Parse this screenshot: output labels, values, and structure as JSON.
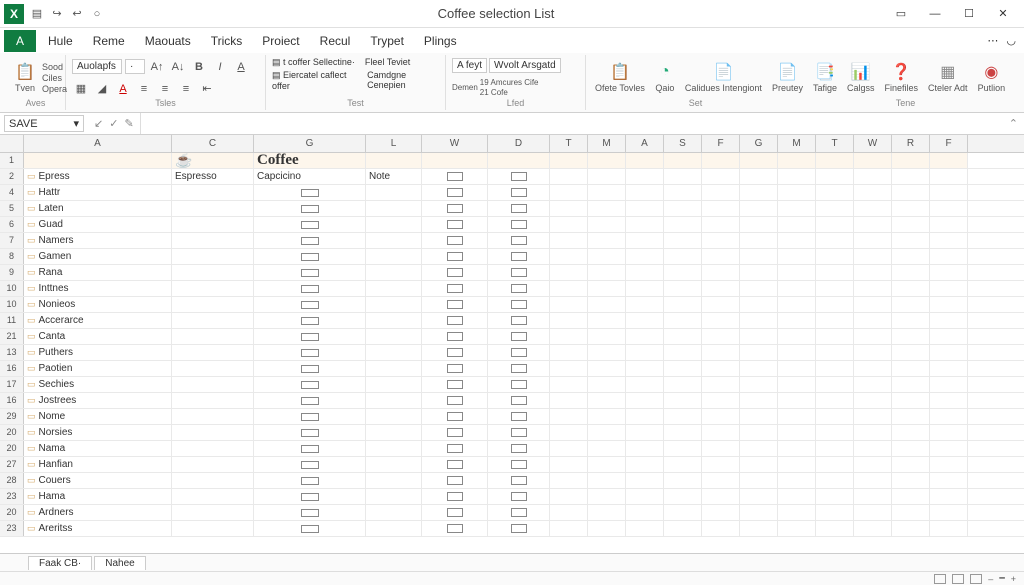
{
  "title": "Coffee selection List",
  "qat": [
    "save-icon",
    "redo-icon",
    "undo-icon",
    "close-icon"
  ],
  "window_buttons": {
    "ribbon_opts": "▭",
    "min": "—",
    "max": "☐",
    "close": "✕"
  },
  "file_tab": "A",
  "tabs": [
    "Hule",
    "Reme",
    "Maouats",
    "Tricks",
    "Proiect",
    "Recul",
    "Trypet",
    "Plings"
  ],
  "ribbon": {
    "paste_group": {
      "paste": "Tven",
      "lines": [
        "Sood",
        "Ciles",
        "Opera"
      ],
      "label": "Aves"
    },
    "font_group": {
      "font": "Auolapfs",
      "size": "·",
      "label": "Tsles"
    },
    "text_group": {
      "line1": "t coffer Sellectine·",
      "line2": "Eiercatel caflect offer",
      "r1": "Fleel Teviet",
      "r2": "Camdgne Cenepien",
      "label": "Test"
    },
    "align_group": {
      "box1": "A feyt",
      "box2": "Wvolt Arsgatd",
      "btn": "Demen",
      "mid": [
        "19 Amcures Cife",
        "21 Cofe"
      ],
      "label": "Lfed"
    },
    "buttons": [
      {
        "icon": "📋",
        "label": "Ofete Tovles",
        "name": "ofete-button",
        "color": "#2a7"
      },
      {
        "icon": "◔",
        "label": "Qaio",
        "name": "qaio-button",
        "color": "#2a7"
      },
      {
        "icon": "📄",
        "label": "Calidues Intengiont",
        "name": "calidues-button",
        "color": "#c33"
      },
      {
        "icon": "📄",
        "label": "Preutey",
        "name": "preutey-button",
        "color": "#888"
      },
      {
        "icon": "📑",
        "label": "Tafige",
        "name": "tafige-button",
        "color": "#c90"
      },
      {
        "icon": "📊",
        "label": "Calgss",
        "name": "calgss-button",
        "color": "#c90"
      },
      {
        "icon": "❓",
        "label": "Finefiles",
        "name": "finefiles-button",
        "color": "#fa0"
      },
      {
        "icon": "▦",
        "label": "Cteler Adt",
        "name": "cteler-button",
        "color": "#888"
      },
      {
        "icon": "◉",
        "label": "Putlion",
        "name": "putlion-button",
        "color": "#c44"
      }
    ],
    "buttons_label": "Set",
    "last_label": "Tene"
  },
  "namebox": "SAVE",
  "columns": [
    "A",
    "C",
    "G",
    "L",
    "W",
    "D",
    "T",
    "M",
    "A",
    "S",
    "F",
    "G",
    "M",
    "T",
    "W",
    "R",
    "F"
  ],
  "header_row": {
    "c_icon": "☕",
    "g": "Coffee"
  },
  "row2": {
    "a": "Epress",
    "c": "Espresso",
    "g": "Capcicino",
    "l": "Note"
  },
  "data_rows": [
    {
      "n": 4,
      "a": "Hattr"
    },
    {
      "n": 5,
      "a": "Laten"
    },
    {
      "n": 6,
      "a": "Guad"
    },
    {
      "n": 7,
      "a": "Namers"
    },
    {
      "n": 8,
      "a": "Gamen"
    },
    {
      "n": 9,
      "a": "Rana"
    },
    {
      "n": 10,
      "a": "Inttnes"
    },
    {
      "n": 10,
      "a": "Nonieos"
    },
    {
      "n": 11,
      "a": "Accerarce"
    },
    {
      "n": 21,
      "a": "Canta"
    },
    {
      "n": 13,
      "a": "Puthers"
    },
    {
      "n": 16,
      "a": "Paotien"
    },
    {
      "n": 17,
      "a": "Sechies"
    },
    {
      "n": 16,
      "a": "Jostrees"
    },
    {
      "n": 29,
      "a": "Nome"
    },
    {
      "n": 20,
      "a": "Norsies"
    },
    {
      "n": 20,
      "a": "Nama"
    },
    {
      "n": 27,
      "a": "Hanfian"
    },
    {
      "n": 28,
      "a": "Couers"
    },
    {
      "n": 23,
      "a": "Hama"
    },
    {
      "n": 20,
      "a": "Ardners"
    },
    {
      "n": 23,
      "a": "Areritss"
    }
  ],
  "sheets": [
    "Faak CB·",
    "Nahee"
  ]
}
